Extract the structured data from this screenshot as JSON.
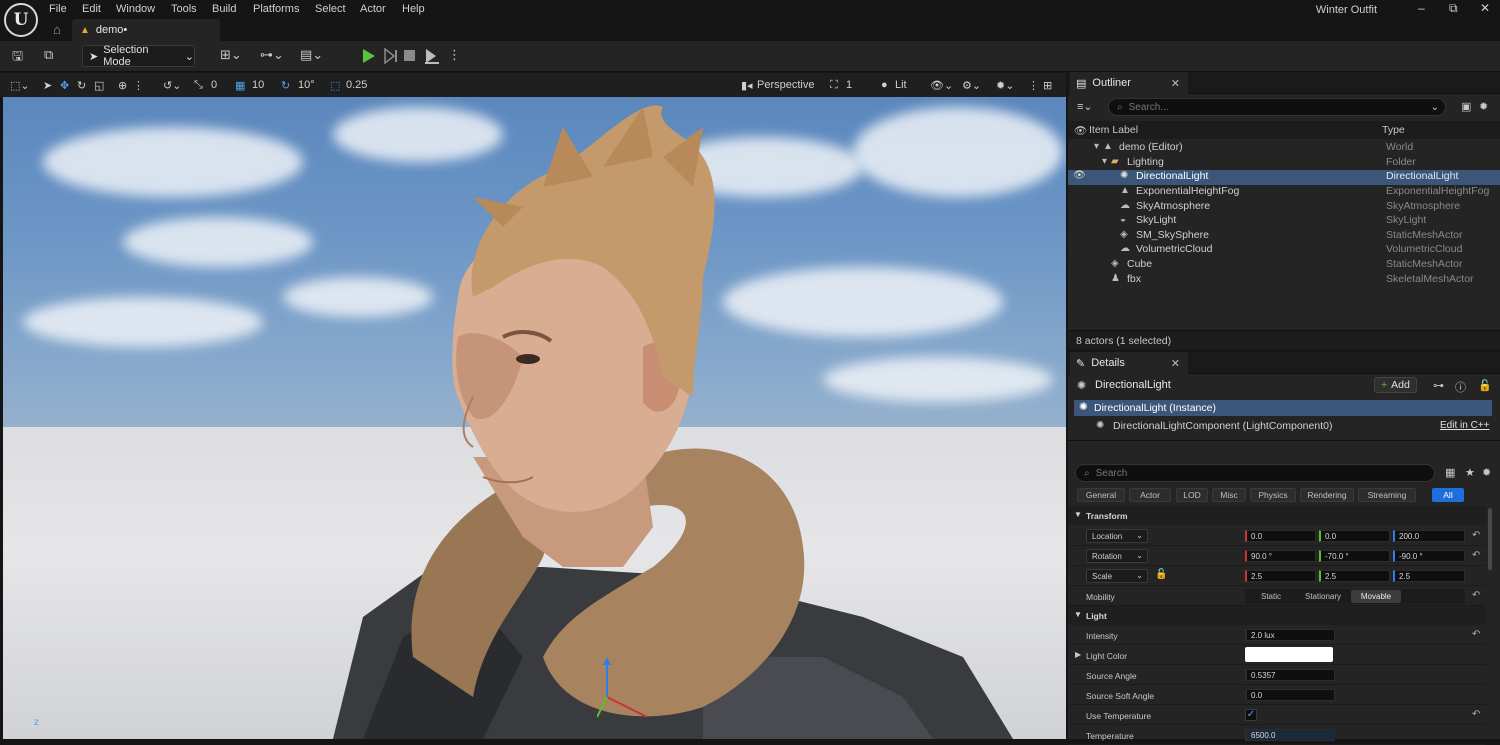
{
  "window": {
    "logo": "U",
    "project_name": "Winter Outfit",
    "menu": [
      "File",
      "Edit",
      "Window",
      "Tools",
      "Build",
      "Platforms",
      "Select",
      "Actor",
      "Help"
    ],
    "controls": {
      "minimize": "–",
      "restore": "⧉",
      "close": "✕"
    },
    "tab_label": "demo•"
  },
  "toolbar": {
    "selection_mode": "Selection Mode"
  },
  "viewport_bar": {
    "snap_translate": "0",
    "grid_size": "10",
    "rotation_snap": "10°",
    "scale_snap": "0.25",
    "perspective": "Perspective",
    "camera_speed": "1",
    "view_mode": "Lit"
  },
  "viewport": {
    "axis_label": "z"
  },
  "outliner": {
    "title": "Outliner",
    "search_placeholder": "Search...",
    "col_label": "Item Label",
    "col_type": "Type",
    "rows": [
      {
        "label": "demo (Editor)",
        "type": "World",
        "icon": "world-icon"
      },
      {
        "label": "Lighting",
        "type": "Folder",
        "icon": "folder-icon"
      },
      {
        "label": "DirectionalLight",
        "type": "DirectionalLight",
        "icon": "directional-light-icon"
      },
      {
        "label": "ExponentialHeightFog",
        "type": "ExponentialHeightFog",
        "icon": "fog-icon"
      },
      {
        "label": "SkyAtmosphere",
        "type": "SkyAtmosphere",
        "icon": "sky-atmosphere-icon"
      },
      {
        "label": "SkyLight",
        "type": "SkyLight",
        "icon": "skylight-icon"
      },
      {
        "label": "SM_SkySphere",
        "type": "StaticMeshActor",
        "icon": "static-mesh-icon"
      },
      {
        "label": "VolumetricCloud",
        "type": "VolumetricCloud",
        "icon": "cloud-icon"
      },
      {
        "label": "Cube",
        "type": "StaticMeshActor",
        "icon": "static-mesh-icon"
      },
      {
        "label": "fbx",
        "type": "SkeletalMeshActor",
        "icon": "skeletal-mesh-icon"
      }
    ],
    "actor_count": "8 actors (1 selected)"
  },
  "details": {
    "title": "Details",
    "actor_name": "DirectionalLight",
    "add_label": "Add",
    "instance_label": "DirectionalLight (Instance)",
    "component_label": "DirectionalLightComponent (LightComponent0)",
    "edit_cpp": "Edit in C++",
    "search_placeholder": "Search",
    "filters": [
      "General",
      "Actor",
      "LOD",
      "Misc",
      "Physics",
      "Rendering",
      "Streaming",
      "All"
    ],
    "transform": {
      "section": "Transform",
      "location_label": "Location",
      "location": [
        "0.0",
        "0.0",
        "200.0"
      ],
      "rotation_label": "Rotation",
      "rotation": [
        "90.0 °",
        "-70.0 °",
        "-90.0 °"
      ],
      "scale_label": "Scale",
      "scale": [
        "2.5",
        "2.5",
        "2.5"
      ],
      "mobility_label": "Mobility",
      "mobility_options": [
        "Static",
        "Stationary",
        "Movable"
      ]
    },
    "light": {
      "section": "Light",
      "intensity_label": "Intensity",
      "intensity": "2.0 lux",
      "color_label": "Light Color",
      "source_angle_label": "Source Angle",
      "source_angle": "0.5357",
      "source_soft_angle_label": "Source Soft Angle",
      "source_soft_angle": "0.0",
      "use_temperature_label": "Use Temperature",
      "temperature_label": "Temperature",
      "temperature": "6500.0"
    }
  },
  "colors": {
    "accent": "#1e6fd9",
    "selection": "#3b5679",
    "play": "#5cc13e"
  }
}
